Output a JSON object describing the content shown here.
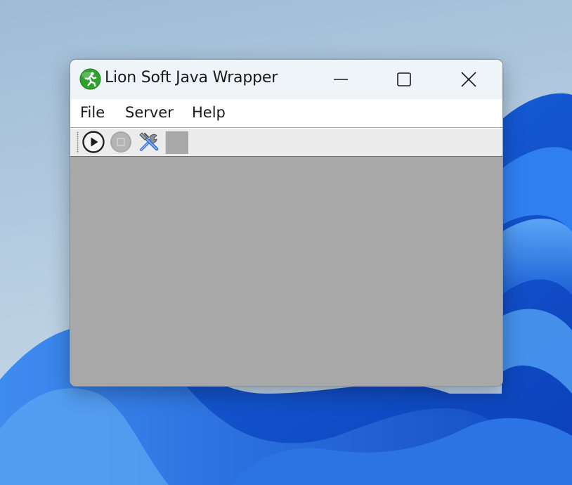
{
  "window": {
    "title": "Lion Soft Java Wrapper",
    "app_icon": "running-man-icon"
  },
  "window_controls": {
    "minimize_icon": "minimize-icon",
    "maximize_icon": "maximize-icon",
    "close_icon": "close-icon"
  },
  "menu": {
    "items": [
      {
        "label": "File"
      },
      {
        "label": "Server"
      },
      {
        "label": "Help"
      }
    ]
  },
  "toolbar": {
    "buttons": [
      {
        "icon": "play-icon",
        "enabled": true
      },
      {
        "icon": "stop-icon",
        "enabled": false
      },
      {
        "icon": "tools-icon",
        "enabled": true
      }
    ]
  },
  "colors": {
    "content_background": "#a8a8a8",
    "titlebar_background": "#eff4f9",
    "app_icon_green": "#2ea12e"
  }
}
